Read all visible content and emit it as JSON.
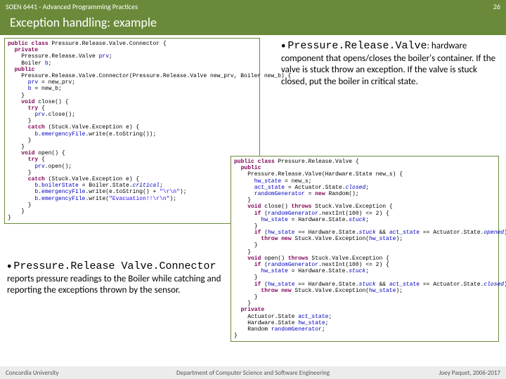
{
  "header": {
    "course": "SOEN 6441 - Advanced Programming Practices",
    "pagenum": "26",
    "title": "Exception handling: example"
  },
  "right_text": {
    "head": "Pressure.Release.Valve",
    "colon": ":",
    "body": "hardware component that opens/closes the boiler's container. If the valve is stuck throw an exception. If the valve is stuck closed, put the boiler in critical state."
  },
  "bottom_text": {
    "head": "Pressure.Release Valve.Connector",
    "rest": " reports pressure readings to the Boiler while catching and reporting the exceptions thrown by the sensor."
  },
  "footer": {
    "left": "Concordia University",
    "center": "Department of Computer Science and Software Engineering",
    "right": "Joey Paquet, 2006-2017"
  },
  "code_left": {
    "l1a": "public",
    "l1b": " class",
    "l1c": " Pressure.Release.Valve.Connector {",
    "l2a": "private",
    "l3a": "    Pressure.Release.Valve ",
    "l3b": "prv",
    "l3c": ";",
    "l4a": "    Boiler ",
    "l4b": "b",
    "l4c": ";",
    "l5a": "public",
    "l6": "    Pressure.Release.Valve.Connector(Pressure.Release.Valve new_prv, Boiler new_b) {",
    "l7a": "      prv",
    "l7b": " = new_prv;",
    "l8a": "      b",
    "l8b": " = new_b;",
    "l9": "    }",
    "l10a": "    void",
    "l10b": " close() {",
    "l11a": "      try",
    "l11b": " {",
    "l12a": "        prv",
    "l12b": ".close();",
    "l13": "      }",
    "l14a": "      catch",
    "l14b": " (Stuck.Valve.Exception e) {",
    "l15a": "        b",
    "l15b": ".",
    "l15c": "emergencyFile",
    "l15d": ".write(e.toString());",
    "l16": "      }",
    "l17": "    }",
    "l18a": "    void",
    "l18b": " open() {",
    "l19a": "      try",
    "l19b": " {",
    "l20a": "        prv",
    "l20b": ".open();",
    "l21": "      }",
    "l22a": "      catch",
    "l22b": " (Stuck.Valve.Exception e) {",
    "l23a": "        b",
    "l23b": ".",
    "l23c": "boilerState",
    "l23d": " = Boiler.State.",
    "l23e": "critical",
    "l23f": ";",
    "l24a": "        b",
    "l24b": ".",
    "l24c": "emergencyFile",
    "l24d": ".write(e.toString() + ",
    "l24e": "\"\\r\\n\"",
    "l24f": ");",
    "l25a": "        b",
    "l25b": ".",
    "l25c": "emergencyFile",
    "l25d": ".write(",
    "l25e": "\"Evacuation!!\\r\\n\"",
    "l25f": ");",
    "l26": "      }",
    "l27": "    }",
    "l28": "}"
  },
  "code_right": {
    "r1a": "public",
    "r1b": " class",
    "r1c": " Pressure.Release.Valve {",
    "r2a": "  public",
    "r3": "    Pressure.Release.Valve(Hardware.State new_s) {",
    "r4a": "      hw_state",
    "r4b": " = new_s;",
    "r5a": "      act_state",
    "r5b": " = Actuator.State.",
    "r5c": "closed",
    "r5d": ";",
    "r6a": "      randomGenerator",
    "r6b": " = ",
    "r6c": "new",
    "r6d": " Random();",
    "r7": "    }",
    "r8a": "    void",
    "r8b": " close() ",
    "r8c": "throws",
    "r8d": " Stuck.Valve.Exception {",
    "r9a": "      if",
    "r9b": " (",
    "r9c": "randomGenerator",
    "r9d": ".nextInt(100) <= 2) {",
    "r10a": "        hw_state",
    "r10b": " = Hardware.State.",
    "r10c": "stuck",
    "r10d": ";",
    "r11": "      }",
    "r12a": "      if",
    "r12b": " (",
    "r12c": "hw_state",
    "r12d": " == Hardware.State.",
    "r12e": "stuck",
    "r12f": " && ",
    "r12g": "act_state",
    "r12h": " == Actuator.State.",
    "r12i": "opened",
    "r12j": ") {",
    "r13a": "        throw",
    "r13b": " new",
    "r13c": " Stuck.Valve.Exception(",
    "r13d": "hw_state",
    "r13e": ");",
    "r14": "      }",
    "r15": "    }",
    "r16a": "    void",
    "r16b": " open() ",
    "r16c": "throws",
    "r16d": " Stuck.Valve.Exception {",
    "r17a": "      if",
    "r17b": " (",
    "r17c": "randomGenerator",
    "r17d": ".nextInt(100) <= 2) {",
    "r18a": "        hw_state",
    "r18b": " = Hardware.State.",
    "r18c": "stuck",
    "r18d": ";",
    "r19": "      }",
    "r20a": "      if",
    "r20b": " (",
    "r20c": "hw_state",
    "r20d": " == Hardware.State.",
    "r20e": "stuck",
    "r20f": " && ",
    "r20g": "act_state",
    "r20h": " == Actuator.State.",
    "r20i": "closed",
    "r20j": ") {",
    "r21a": "        throw",
    "r21b": " new",
    "r21c": " Stuck.Valve.Exception(",
    "r21d": "hw_state",
    "r21e": ");",
    "r22": "      }",
    "r23": "    }",
    "r24a": "  private",
    "r25a": "    Actuator.State ",
    "r25b": "act_state",
    "r25c": ";",
    "r26a": "    Hardware.State ",
    "r26b": "hw_state",
    "r26c": ";",
    "r27a": "    Random ",
    "r27b": "randomGenerator",
    "r27c": ";",
    "r28": "}"
  }
}
